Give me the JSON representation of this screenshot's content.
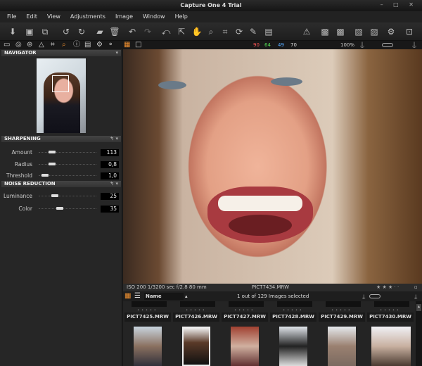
{
  "window": {
    "title": "Capture One 4 Trial",
    "controls": "– □ ✕"
  },
  "menu": [
    "File",
    "Edit",
    "View",
    "Adjustments",
    "Image",
    "Window",
    "Help"
  ],
  "toolbar": {
    "zoom": "100%"
  },
  "readout": {
    "r": "90",
    "g": "64",
    "b": "49",
    "l": "70",
    "colors": {
      "r": "#ff5555",
      "g": "#55dd55",
      "b": "#55aaff",
      "l": "#dddddd"
    }
  },
  "navigator": {
    "title": "NAVIGATOR"
  },
  "sharpening": {
    "title": "SHARPENING",
    "rows": [
      {
        "label": "Amount",
        "value": "113",
        "pos": 0.2
      },
      {
        "label": "Radius",
        "value": "0,8",
        "pos": 0.2
      },
      {
        "label": "Threshold",
        "value": "1,0",
        "pos": 0.05
      }
    ]
  },
  "noise": {
    "title": "NOISE REDUCTION",
    "rows": [
      {
        "label": "Luminance",
        "value": "25",
        "pos": 0.25
      },
      {
        "label": "Color",
        "value": "35",
        "pos": 0.35
      }
    ]
  },
  "info": {
    "exif": "ISO 200  1/3200 sec  f/2.8  80 mm",
    "filename": "PICT7434.MRW",
    "rating": "★ ★ ★ · ·"
  },
  "browser": {
    "sort": "Name",
    "status": "1 out of 129 Images selected"
  },
  "filmstrip": [
    "PICT7425.MRW",
    "PICT7426.MRW",
    "PICT7427.MRW",
    "PICT7428.MRW",
    "PICT7429.MRW",
    "PICT7430.MRW"
  ]
}
